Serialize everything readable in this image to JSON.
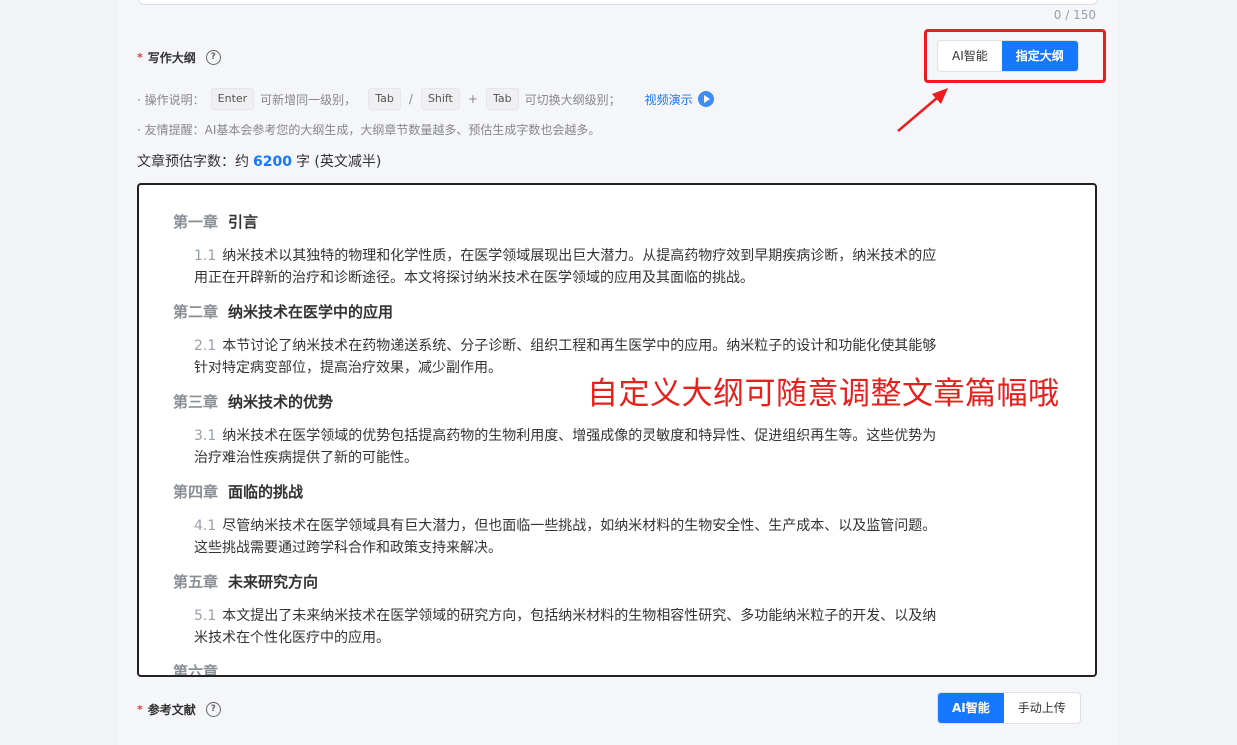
{
  "top": {
    "counter": "0 / 150"
  },
  "outline_section": {
    "title": "写作大纲",
    "toggle": {
      "ai_label": "AI智能",
      "manual_label": "指定大纲",
      "active": "manual"
    },
    "instructions": {
      "prefix": "· 操作说明：",
      "key_enter": "Enter",
      "text1": "可新增同一级别，",
      "key_tab": "Tab",
      "slash": "/",
      "key_shift": "Shift",
      "plus": "+",
      "key_tab2": "Tab",
      "text2": "可切换大纲级别；",
      "video_link": "视频演示"
    },
    "reminder": "· 友情提醒：AI基本会参考您的大纲生成，大纲章节数量越多、预估生成字数也会越多。",
    "estimate": {
      "prefix": "文章预估字数：约",
      "value": "6200",
      "suffix": "字 (英文减半)"
    }
  },
  "outline": [
    {
      "num": "第一章",
      "title": "引言",
      "sec": "1.1",
      "line1": "纳米技术以其独特的物理和化学性质，在医学领域展现出巨大潜力。从提高药物疗效到早期疾病诊断，纳米技术的应",
      "line2": "用正在开辟新的治疗和诊断途径。本文将探讨纳米技术在医学领域的应用及其面临的挑战。"
    },
    {
      "num": "第二章",
      "title": "纳米技术在医学中的应用",
      "sec": "2.1",
      "line1": "本节讨论了纳米技术在药物递送系统、分子诊断、组织工程和再生医学中的应用。纳米粒子的设计和功能化使其能够",
      "line2": "针对特定病变部位，提高治疗效果，减少副作用。"
    },
    {
      "num": "第三章",
      "title": "纳米技术的优势",
      "sec": "3.1",
      "line1": "纳米技术在医学领域的优势包括提高药物的生物利用度、增强成像的灵敏度和特异性、促进组织再生等。这些优势为",
      "line2": "治疗难治性疾病提供了新的可能性。"
    },
    {
      "num": "第四章",
      "title": "面临的挑战",
      "sec": "4.1",
      "line1": "尽管纳米技术在医学领域具有巨大潜力，但也面临一些挑战，如纳米材料的生物安全性、生产成本、以及监管问题。",
      "line2": "这些挑战需要通过跨学科合作和政策支持来解决。"
    },
    {
      "num": "第五章",
      "title": "未来研究方向",
      "sec": "5.1",
      "line1": "本文提出了未来纳米技术在医学领域的研究方向，包括纳米材料的生物相容性研究、多功能纳米粒子的开发、以及纳",
      "line2": "米技术在个性化医疗中的应用。"
    },
    {
      "num": "第六章",
      "title": "",
      "sec": "",
      "line1": "",
      "line2": ""
    }
  ],
  "annotation": "自定义大纲可随意调整文章篇幅哦",
  "references_section": {
    "title": "参考文献",
    "toggle": {
      "ai_label": "AI智能",
      "manual_label": "手动上传",
      "active": "ai"
    }
  },
  "colors": {
    "accent": "#1677ff",
    "highlight": "#ee1c1c"
  }
}
